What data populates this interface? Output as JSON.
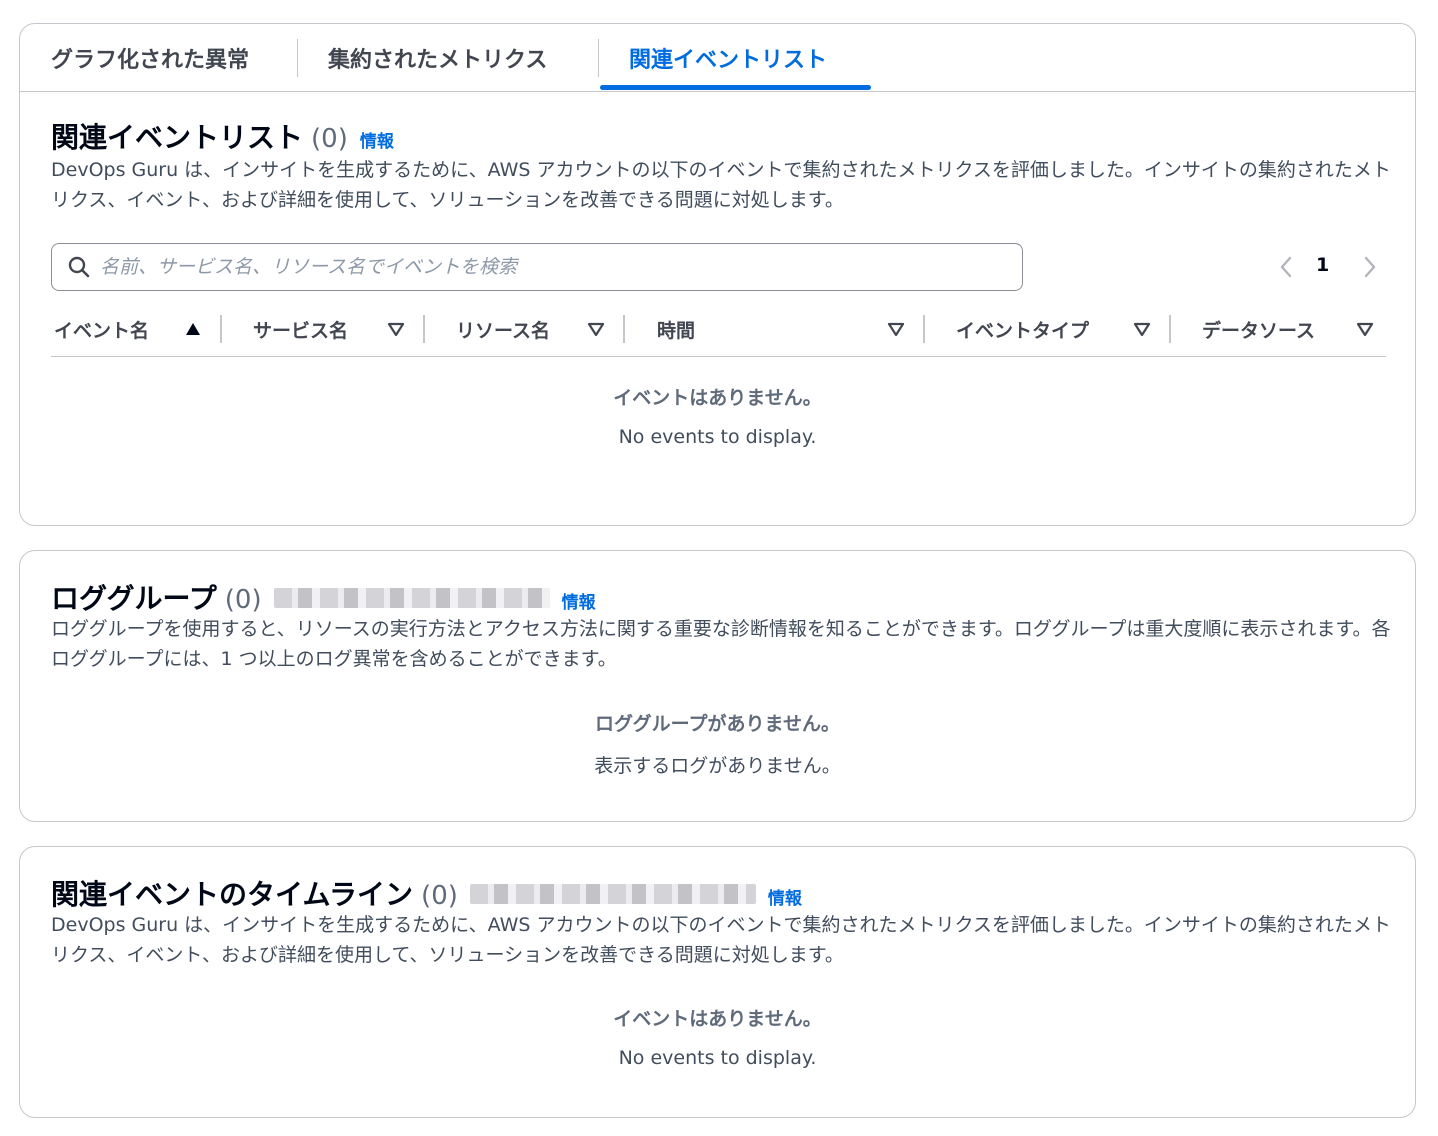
{
  "tabs": [
    {
      "label": "グラフ化された異常"
    },
    {
      "label": "集約されたメトリクス"
    },
    {
      "label": "関連イベントリスト"
    }
  ],
  "events_section": {
    "title": "関連イベントリスト",
    "count": "(0)",
    "info": "情報",
    "description": "DevOps Guru は、インサイトを生成するために、AWS アカウントの以下のイベントで集約されたメトリクスを評価しました。インサイトの集約されたメトリクス、イベント、および詳細を使用して、ソリューションを改善できる問題に対処します。",
    "search_placeholder": "名前、サービス名、リソース名でイベントを検索",
    "page": "1",
    "columns": [
      "イベント名",
      "サービス名",
      "リソース名",
      "時間",
      "イベントタイプ",
      "データソース"
    ],
    "empty_title": "イベントはありません。",
    "empty_sub": "No events to display."
  },
  "logs_section": {
    "title": "ロググループ",
    "count": "(0)",
    "info": "情報",
    "description": "ロググループを使用すると、リソースの実行方法とアクセス方法に関する重要な診断情報を知ることができます。ロググループは重大度順に表示されます。各ロググループには、1 つ以上のログ異常を含めることができます。",
    "empty_title": "ロググループがありません。",
    "empty_sub": "表示するログがありません。"
  },
  "timeline_section": {
    "title": "関連イベントのタイムライン",
    "count": "(0)",
    "info": "情報",
    "description": "DevOps Guru は、インサイトを生成するために、AWS アカウントの以下のイベントで集約されたメトリクスを評価しました。インサイトの集約されたメトリクス、イベント、および詳細を使用して、ソリューションを改善できる問題に対処します。",
    "empty_title": "イベントはありません。",
    "empty_sub": "No events to display."
  },
  "colors": {
    "accent": "#006ce0",
    "border": "#c6c6cd",
    "text": "#000716",
    "muted": "#5f6b7a"
  }
}
